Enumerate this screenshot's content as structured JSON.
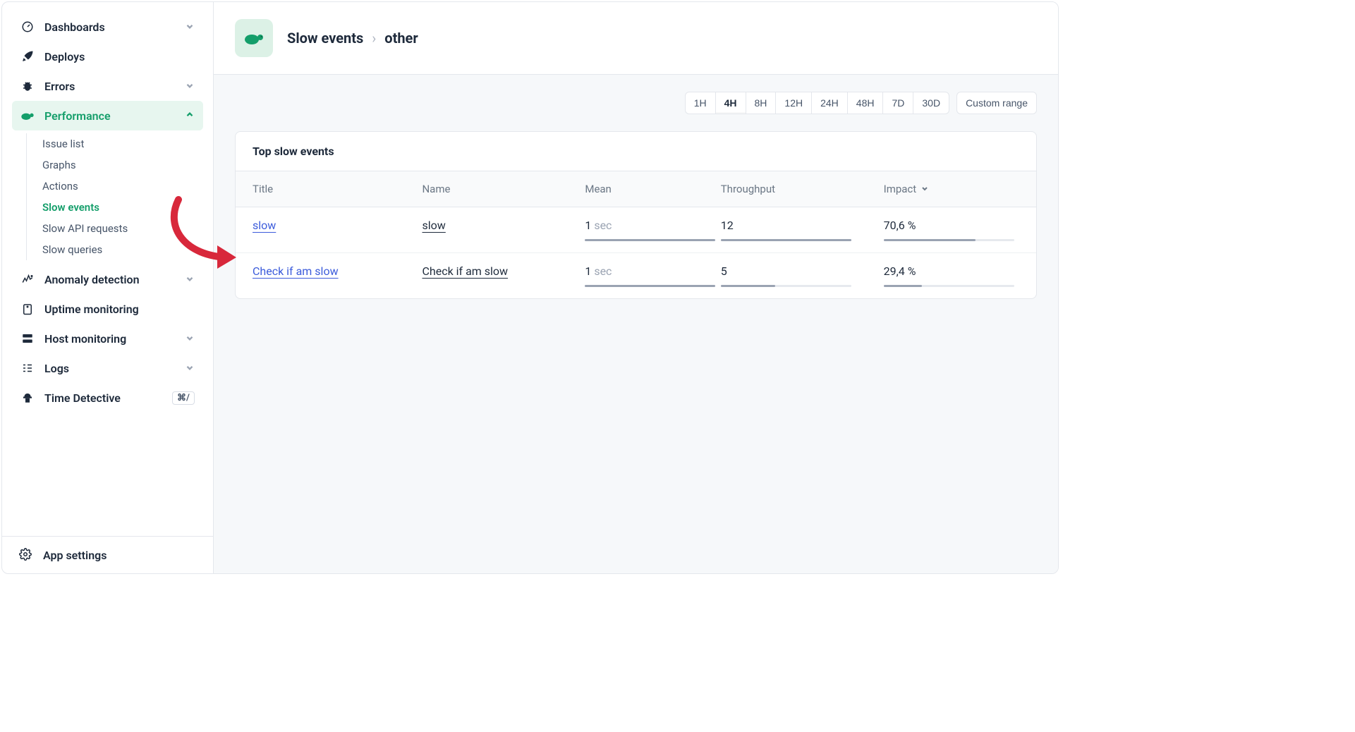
{
  "sidebar": {
    "items": [
      {
        "label": "Dashboards",
        "icon": "gauge-icon",
        "expandable": true
      },
      {
        "label": "Deploys",
        "icon": "rocket-icon",
        "expandable": false
      },
      {
        "label": "Errors",
        "icon": "bug-icon",
        "expandable": true
      },
      {
        "label": "Performance",
        "icon": "turtle-icon",
        "expandable": true,
        "active": true,
        "children": [
          {
            "label": "Issue list"
          },
          {
            "label": "Graphs"
          },
          {
            "label": "Actions"
          },
          {
            "label": "Slow events",
            "active": true
          },
          {
            "label": "Slow API requests"
          },
          {
            "label": "Slow queries"
          }
        ]
      },
      {
        "label": "Anomaly detection",
        "icon": "anomaly-icon",
        "expandable": true
      },
      {
        "label": "Uptime monitoring",
        "icon": "uptime-icon",
        "expandable": false
      },
      {
        "label": "Host monitoring",
        "icon": "server-icon",
        "expandable": true
      },
      {
        "label": "Logs",
        "icon": "logs-icon",
        "expandable": true
      },
      {
        "label": "Time Detective",
        "icon": "detective-icon",
        "badge": "⌘/"
      }
    ],
    "footer": {
      "label": "App settings"
    }
  },
  "header": {
    "breadcrumb": [
      "Slow events",
      "other"
    ]
  },
  "time_range": {
    "options": [
      "1H",
      "4H",
      "8H",
      "12H",
      "24H",
      "48H",
      "7D",
      "30D"
    ],
    "custom_label": "Custom range",
    "selected": "4H"
  },
  "panel": {
    "title": "Top slow events",
    "columns": [
      "Title",
      "Name",
      "Mean",
      "Throughput",
      "Impact"
    ],
    "sort_col": "Impact",
    "rows": [
      {
        "title": "slow",
        "name": "slow",
        "mean_val": "1",
        "mean_unit": "sec",
        "mean_pct": 100,
        "throughput": "12",
        "throughput_pct": 100,
        "impact": "70,6 %",
        "impact_pct": 70.6
      },
      {
        "title": "Check if am slow",
        "name": "Check if am slow",
        "mean_val": "1",
        "mean_unit": "sec",
        "mean_pct": 100,
        "throughput": "5",
        "throughput_pct": 42,
        "impact": "29,4 %",
        "impact_pct": 29.4
      }
    ]
  }
}
